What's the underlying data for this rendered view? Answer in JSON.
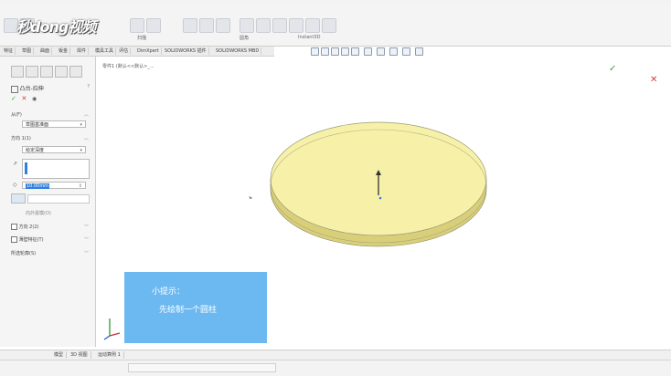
{
  "watermark": {
    "logo_text": "秒dong视频"
  },
  "ribbon": {
    "labels": [
      "拉伸凸台/基体",
      "旋转凸台/基体",
      "扫描",
      "放样凸台/基体",
      "拉伸切除",
      "异型孔向导",
      "旋转切除",
      "圆角",
      "线性阵列",
      "筋",
      "拔模",
      "抽壳",
      "包覆",
      "相交",
      "参考几何体",
      "曲线",
      "Instant3D"
    ]
  },
  "command_tabs": [
    "特征",
    "草图",
    "曲面",
    "钣金",
    "焊件",
    "模具工具",
    "评估",
    "DimXpert",
    "SOLIDWORKS 插件",
    "SOLIDWORKS MBD"
  ],
  "tree_path": "零件1 (默认<<默认>_...",
  "property_manager": {
    "title": "凸台-拉伸",
    "from_section": "从(F)",
    "from_value": "草图基准面",
    "direction_section": "方向 1(1)",
    "direction_type": "给定深度",
    "depth_value": "10.00mm",
    "draft_label": "向外拔模(O)",
    "direction2": "方向 2(2)",
    "thin_feature": "薄壁特征(T)",
    "selected_contours": "所选轮廓(S)"
  },
  "tip": {
    "title": "小提示：",
    "body": "先绘制一个圆柱"
  },
  "bottom_tabs": [
    "模型",
    "3D 视图",
    "运动算例 1"
  ],
  "colors": {
    "disc_top": "#f6f0a8",
    "disc_side": "#d9cf7a",
    "tip_bg": "#6cb8f0",
    "accept_green": "#3aa43a",
    "cancel_red": "#d04040"
  }
}
